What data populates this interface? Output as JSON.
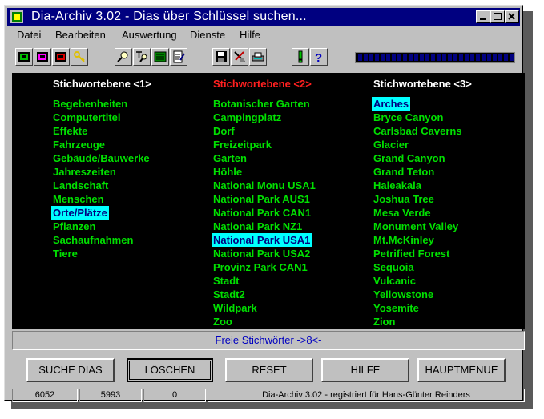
{
  "window": {
    "title": "Dia-Archiv 3.02 - Dias über Schlüssel suchen..."
  },
  "menu": [
    "Datei",
    "Bearbeiten",
    "Auswertung",
    "Dienste",
    "Hilfe"
  ],
  "colors": {
    "titlebar": "#000080",
    "item": "#00e000",
    "selected_bg": "#00ffff",
    "active_header": "#ff2020"
  },
  "columns": [
    {
      "header": "Stichwortebene <1>",
      "items": [
        "Begebenheiten",
        "Computertitel",
        "Effekte",
        "Fahrzeuge",
        "Gebäude/Bauwerke",
        "Jahreszeiten",
        "Landschaft",
        "Menschen",
        "Orte/Plätze",
        "Pflanzen",
        "Sachaufnahmen",
        "Tiere"
      ],
      "selected": 8
    },
    {
      "header": "Stichwortebene <2>",
      "items": [
        "Botanischer Garten",
        "Campingplatz",
        "Dorf",
        "Freizeitpark",
        "Garten",
        "Höhle",
        "National Monu USA1",
        "National Park AUS1",
        "National Park CAN1",
        "National Park NZ1",
        "National Park USA1",
        "National Park USA2",
        "Provinz  Park CAN1",
        "Stadt",
        "Stadt2",
        "Wildpark",
        "Zoo"
      ],
      "selected": 10
    },
    {
      "header": "Stichwortebene <3>",
      "items": [
        "Arches",
        "Bryce Canyon",
        "Carlsbad Caverns",
        "Glacier",
        "Grand Canyon",
        "Grand Teton",
        "Haleakala",
        "Joshua Tree",
        "Mesa Verde",
        "Monument Valley",
        "Mt.McKinley",
        "Petrified Forest",
        "Sequoia",
        "Vulcanic",
        "Yellowstone",
        "Yosemite",
        "Zion"
      ],
      "selected": 0
    }
  ],
  "free_keywords": "Freie Stichwörter ->8<-",
  "buttons": {
    "search": "SUCHE DIAS",
    "delete": "LÖSCHEN",
    "reset": "RESET",
    "help": "HILFE",
    "main": "HAUPTMENUE"
  },
  "status": {
    "count1": "6052",
    "count2": "5993",
    "count3": "0",
    "registration": "Dia-Archiv 3.02 - registriert für Hans-Günter Reinders"
  },
  "toolbar_icons": [
    "frame-green-icon",
    "frame-magenta-icon",
    "frame-red-icon",
    "key-icon",
    "zoom-icon",
    "zoom-text-icon",
    "list-icon",
    "notepad-icon",
    "save-icon",
    "tools-icon",
    "printer-icon",
    "exclamation-icon",
    "question-icon"
  ]
}
